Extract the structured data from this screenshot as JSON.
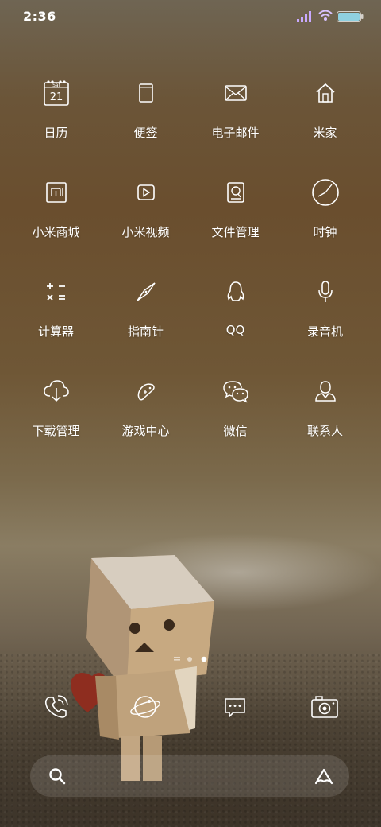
{
  "status_bar": {
    "time": "2:36",
    "battery_color": "#8fd0e0"
  },
  "apps": [
    {
      "label": "日历",
      "icon": "calendar-icon",
      "calendar_day": "Sat",
      "calendar_date": "21"
    },
    {
      "label": "便签",
      "icon": "notes-icon"
    },
    {
      "label": "电子邮件",
      "icon": "email-icon"
    },
    {
      "label": "米家",
      "icon": "home-icon"
    },
    {
      "label": "小米商城",
      "icon": "mi-store-icon"
    },
    {
      "label": "小米视频",
      "icon": "video-icon"
    },
    {
      "label": "文件管理",
      "icon": "file-manager-icon"
    },
    {
      "label": "时钟",
      "icon": "clock-icon"
    },
    {
      "label": "计算器",
      "icon": "calculator-icon"
    },
    {
      "label": "指南针",
      "icon": "compass-icon"
    },
    {
      "label": "QQ",
      "icon": "qq-icon"
    },
    {
      "label": "录音机",
      "icon": "recorder-icon"
    },
    {
      "label": "下载管理",
      "icon": "download-icon"
    },
    {
      "label": "游戏中心",
      "icon": "game-center-icon"
    },
    {
      "label": "微信",
      "icon": "wechat-icon"
    },
    {
      "label": "联系人",
      "icon": "contacts-icon"
    }
  ],
  "page_indicator": {
    "pages": 2,
    "current": 2
  },
  "dock": [
    {
      "icon": "phone-icon"
    },
    {
      "icon": "browser-icon"
    },
    {
      "icon": "messages-icon"
    },
    {
      "icon": "camera-icon"
    }
  ],
  "search_bar": {
    "left_icon": "search-icon",
    "right_icon": "assistant-icon"
  }
}
